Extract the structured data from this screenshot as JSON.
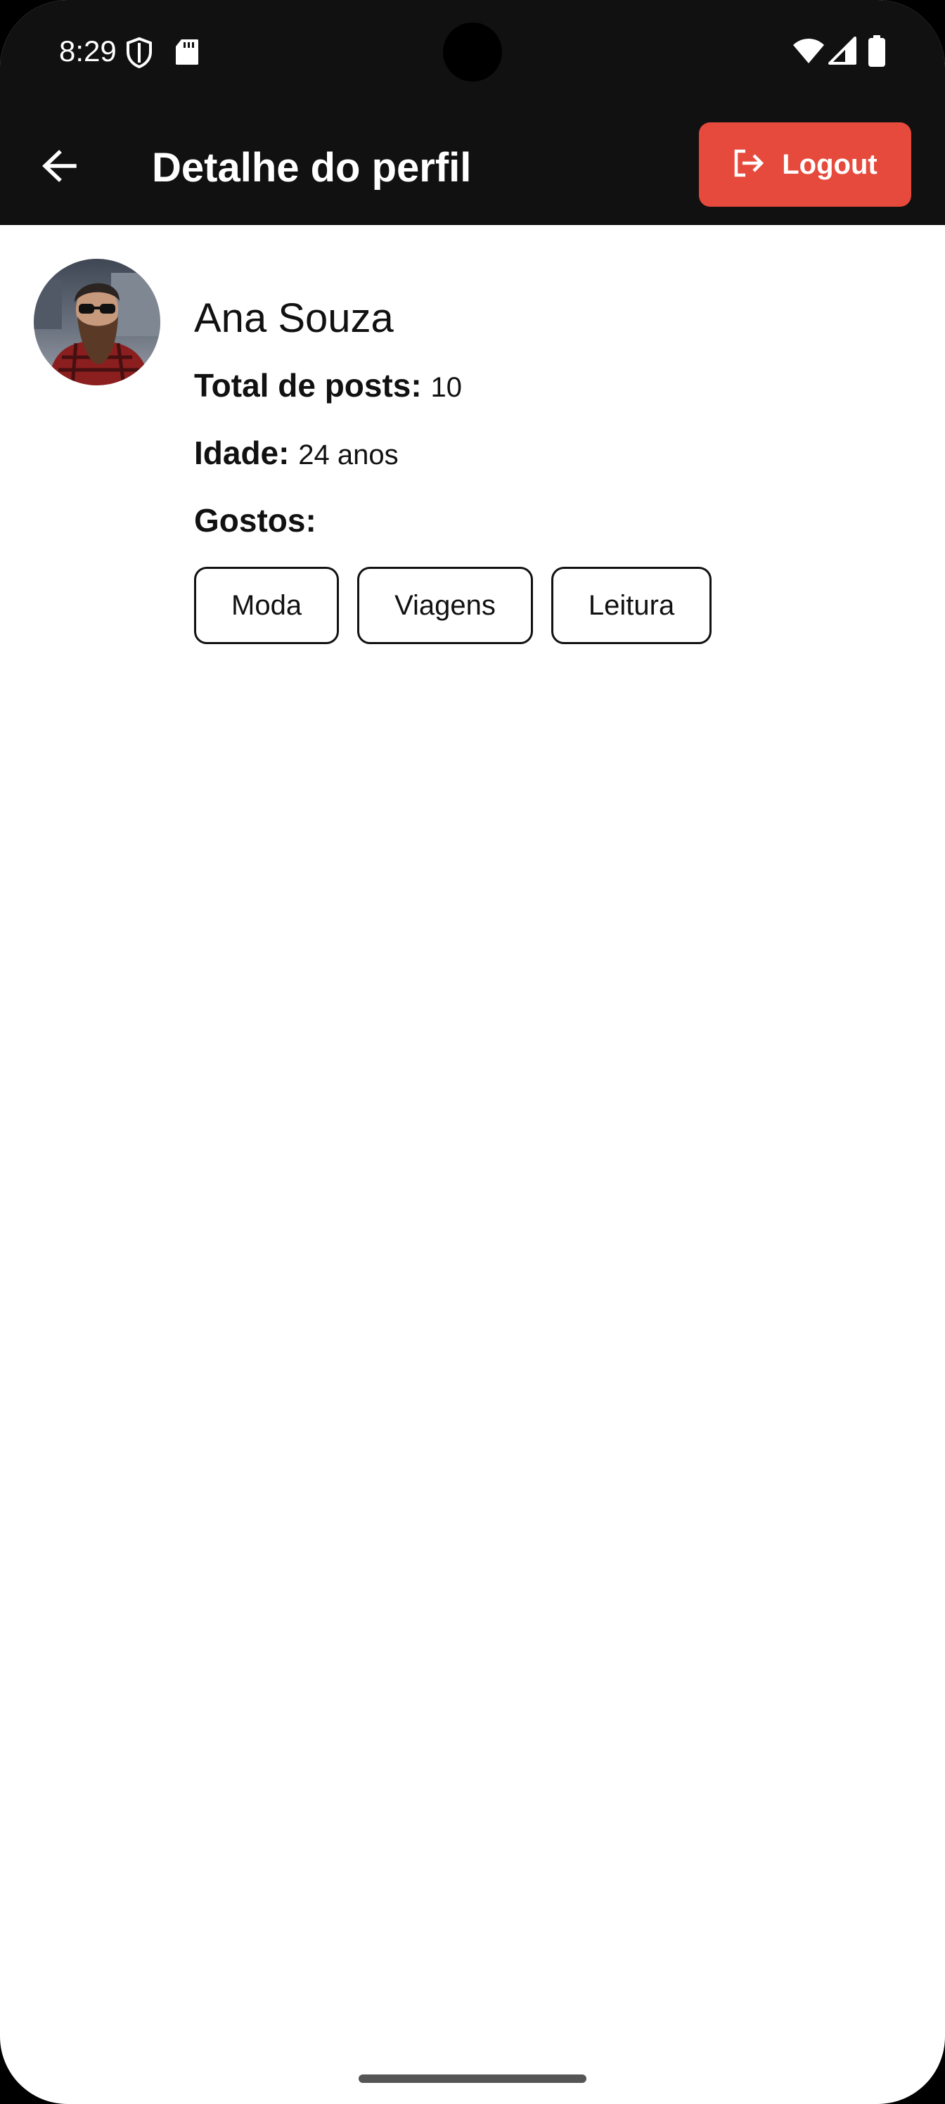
{
  "status_bar": {
    "time": "8:29",
    "left_icons": [
      "shield-icon",
      "sd-card-icon"
    ],
    "right_icons": [
      "wifi-icon",
      "cellular-signal-icon",
      "battery-icon"
    ]
  },
  "app_bar": {
    "title": "Detalhe do perfil",
    "back_icon": "arrow-back-icon",
    "logout": {
      "label": "Logout",
      "icon": "logout-icon",
      "color": "#e64a3c"
    }
  },
  "profile": {
    "name": "Ana Souza",
    "total_posts_label": "Total de posts:",
    "total_posts_value": "10",
    "age_label": "Idade:",
    "age_value": "24 anos",
    "likes_label": "Gostos:",
    "likes": [
      "Moda",
      "Viagens",
      "Leitura"
    ]
  },
  "colors": {
    "app_bar": "#111111",
    "accent": "#e64a3c",
    "background": "#ffffff"
  }
}
